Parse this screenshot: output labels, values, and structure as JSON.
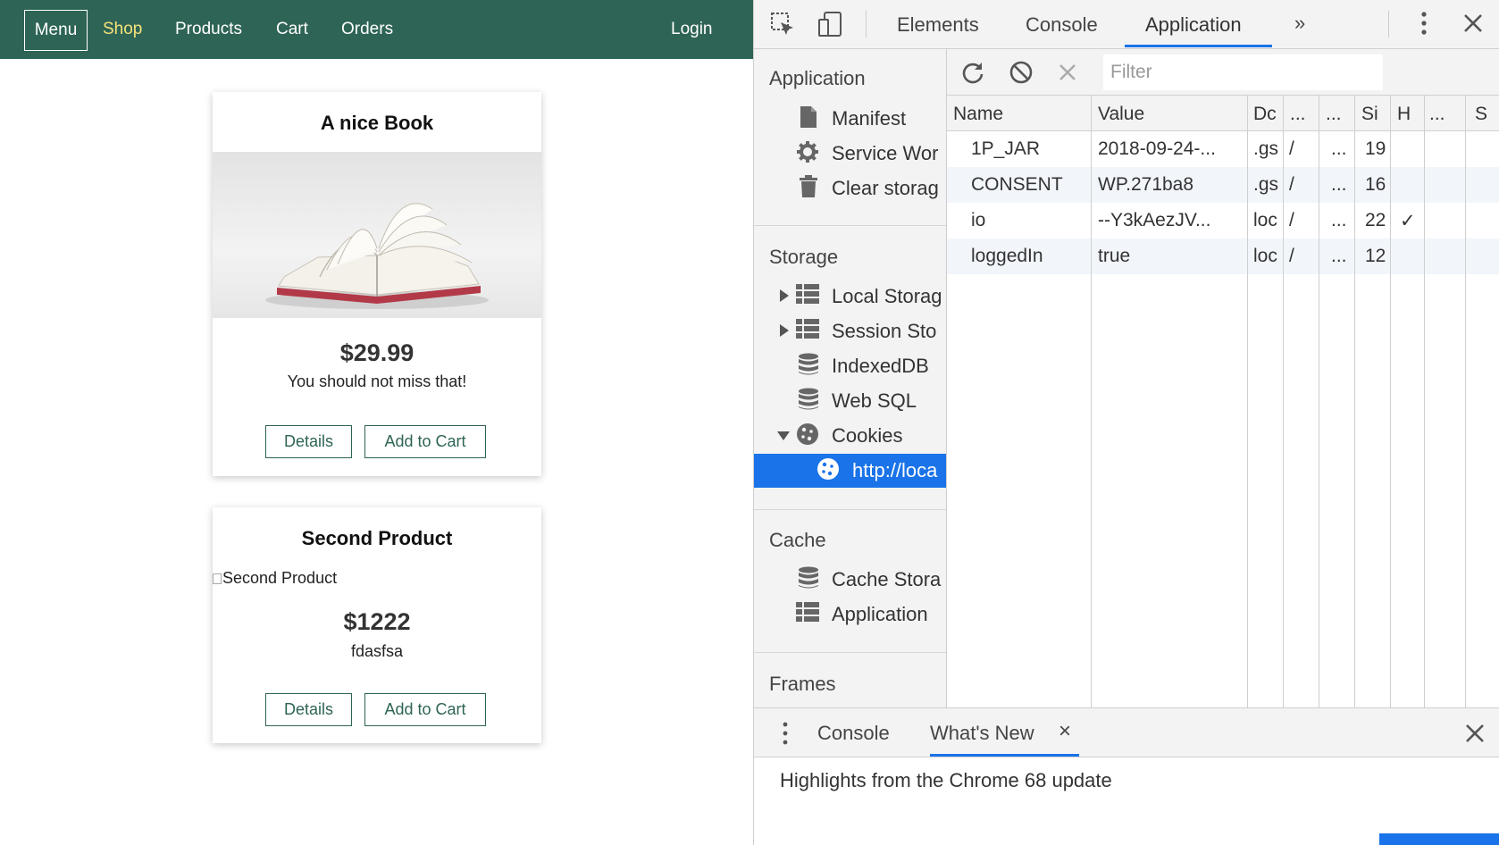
{
  "navbar": {
    "menu_label": "Menu",
    "links": [
      "Shop",
      "Products",
      "Cart",
      "Orders"
    ],
    "login_label": "Login",
    "accent_color": "#f5e27a",
    "bg_color": "#2e6455"
  },
  "products": [
    {
      "title": "A nice Book",
      "image_alt": "",
      "price": "$29.99",
      "description": "You should not miss that!",
      "details_label": "Details",
      "add_to_cart_label": "Add to Cart"
    },
    {
      "title": "Second Product",
      "image_alt": "Second Product",
      "price": "$1222",
      "description": "fdasfsa",
      "details_label": "Details",
      "add_to_cart_label": "Add to Cart"
    }
  ],
  "devtools": {
    "tabs": [
      "Elements",
      "Console",
      "Application"
    ],
    "active_tab": "Application",
    "more_tabs_glyph": "»",
    "sidebar": {
      "application_header": "Application",
      "application_items": [
        "Manifest",
        "Service Wor",
        "Clear storag"
      ],
      "storage_header": "Storage",
      "storage_items": [
        "Local Storag",
        "Session Sto",
        "IndexedDB",
        "Web SQL",
        "Cookies"
      ],
      "cookie_origin": "http://loca",
      "cache_header": "Cache",
      "cache_items": [
        "Cache Stora",
        "Application"
      ],
      "frames_header": "Frames"
    },
    "filter_placeholder": "Filter",
    "columns": [
      "Name",
      "Value",
      "Dc",
      "...",
      "...",
      "Si",
      "H",
      "...",
      "S"
    ],
    "cookies": [
      {
        "name": "1P_JAR",
        "value": "2018-09-24-...",
        "domain": ".gs",
        "path": "/",
        "expires": "...",
        "size": "19",
        "http": ""
      },
      {
        "name": "CONSENT",
        "value": "WP.271ba8",
        "domain": ".gs",
        "path": "/",
        "expires": "...",
        "size": "16",
        "http": ""
      },
      {
        "name": "io",
        "value": "--Y3kAezJV...",
        "domain": "loc",
        "path": "/",
        "expires": "...",
        "size": "22",
        "http": "✓"
      },
      {
        "name": "loggedIn",
        "value": "true",
        "domain": "loc",
        "path": "/",
        "expires": "...",
        "size": "12",
        "http": ""
      }
    ],
    "drawer": {
      "tabs": [
        "Console",
        "What's New"
      ],
      "active_tab": "What's New",
      "close_glyph": "×",
      "highlight_text": "Highlights from the Chrome 68 update"
    },
    "accent_color": "#1a73e8"
  }
}
